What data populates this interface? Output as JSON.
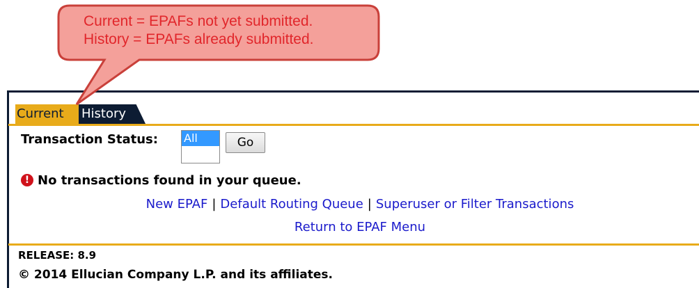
{
  "callout": {
    "line1": "Current = EPAFs not yet submitted.",
    "line2": "History = EPAFs already submitted.",
    "fill_color": "#f4a09a",
    "border_color": "#c9403a",
    "text_color": "#e1262b"
  },
  "tabs": [
    {
      "label": "Current",
      "active": true
    },
    {
      "label": "History",
      "active": false
    }
  ],
  "status": {
    "label": "Transaction Status:",
    "options": [
      "All"
    ],
    "selected": "All",
    "go_label": "Go"
  },
  "message": {
    "icon": "error-icon",
    "icon_glyph": "!",
    "text": "No transactions found in your queue."
  },
  "links": {
    "new_epaf": "New EPAF",
    "default_routing": "Default Routing Queue",
    "superuser": "Superuser or Filter Transactions",
    "return_menu": "Return to EPAF Menu",
    "separator": "|"
  },
  "footer": {
    "release": "RELEASE: 8.9",
    "copyright": "© 2014 Ellucian Company L.P. and its affiliates."
  },
  "colors": {
    "tab_active": "#e8ab1a",
    "tab_inactive": "#0d1c33",
    "link": "#1a1acb",
    "rule": "#e8ab1a"
  }
}
